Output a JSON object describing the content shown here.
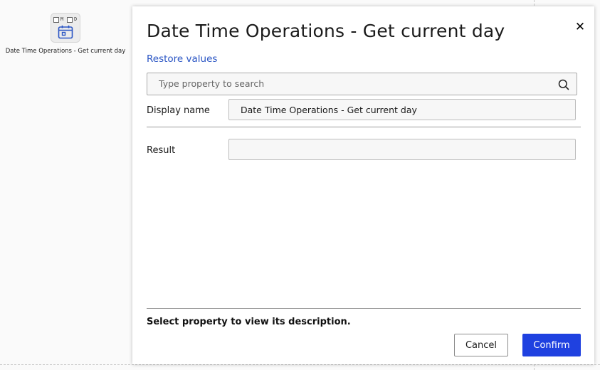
{
  "canvas": {
    "node": {
      "label": "Date Time Operations - Get current day",
      "icon": "calendar-icon",
      "mini_letters": [
        "M",
        "D"
      ]
    }
  },
  "dialog": {
    "title": "Date Time Operations - Get current day",
    "close_icon": "close-icon",
    "restore_label": "Restore values",
    "search": {
      "placeholder": "Type property to search",
      "value": "",
      "icon": "search-icon"
    },
    "properties": [
      {
        "label": "Display name",
        "value": "Date Time Operations - Get current day"
      },
      {
        "label": "Result",
        "value": ""
      }
    ],
    "description": "Select property to view its description.",
    "buttons": {
      "cancel": "Cancel",
      "confirm": "Confirm"
    }
  },
  "colors": {
    "accent": "#1f41e0",
    "link": "#2a55c4",
    "field_bg": "#f7f7f7"
  }
}
